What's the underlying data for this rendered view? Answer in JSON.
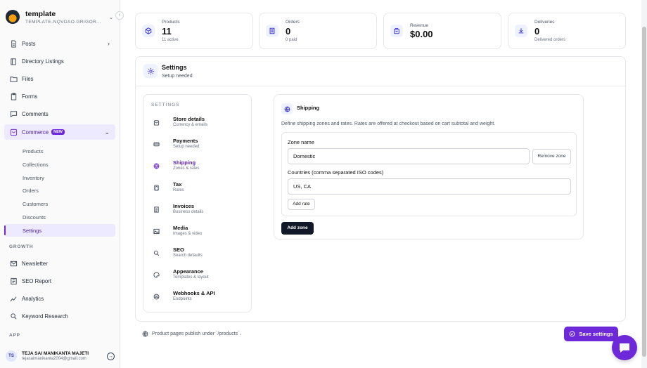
{
  "workspace": {
    "name": "template",
    "slug": "TEMPLATE-NQVDAO.GRIGOR..."
  },
  "sidebar": {
    "items": [
      {
        "label": "Posts",
        "icon": "document-icon"
      },
      {
        "label": "Directory Listings",
        "icon": "book-icon"
      },
      {
        "label": "Files",
        "icon": "folder-icon"
      },
      {
        "label": "Forms",
        "icon": "clipboard-icon"
      },
      {
        "label": "Comments",
        "icon": "comment-icon"
      },
      {
        "label": "Commerce",
        "icon": "cart-icon",
        "badge": "NEW"
      }
    ],
    "commerce_sub": [
      "Products",
      "Collections",
      "Inventory",
      "Orders",
      "Customers",
      "Discounts",
      "Settings"
    ],
    "growth_heading": "GROWTH",
    "growth_items": [
      {
        "label": "Newsletter",
        "icon": "mail-icon"
      },
      {
        "label": "SEO Report",
        "icon": "report-icon"
      },
      {
        "label": "Analytics",
        "icon": "chart-icon"
      },
      {
        "label": "Keyword Research",
        "icon": "search-icon"
      }
    ],
    "app_heading": "APP"
  },
  "user": {
    "initials": "TS",
    "name": "TEJA SAI MANIKANTA MAJETI",
    "email": "tejasaimanikanta2004@gmail.com"
  },
  "stats": [
    {
      "label": "Products",
      "value": "11",
      "sub": "11 active",
      "icon": "cube-icon"
    },
    {
      "label": "Orders",
      "value": "0",
      "sub": "0 paid",
      "icon": "receipt-icon"
    },
    {
      "label": "Revenue",
      "value": "$0.00",
      "sub": "",
      "icon": "bag-icon"
    },
    {
      "label": "Deliveries",
      "value": "0",
      "sub": "Delivered orders",
      "icon": "download-icon"
    }
  ],
  "settings": {
    "title": "Settings",
    "subtitle": "Setup needed",
    "nav_heading": "SETTINGS",
    "nav": [
      {
        "title": "Store details",
        "sub": "Currency & emails",
        "icon": "store-icon"
      },
      {
        "title": "Payments",
        "sub": "Setup needed",
        "icon": "card-icon"
      },
      {
        "title": "Shipping",
        "sub": "Zones & rates",
        "icon": "globe-icon"
      },
      {
        "title": "Tax",
        "sub": "Rates",
        "icon": "calculator-icon"
      },
      {
        "title": "Invoices",
        "sub": "Business details",
        "icon": "invoice-icon"
      },
      {
        "title": "Media",
        "sub": "Images & video",
        "icon": "image-icon"
      },
      {
        "title": "SEO",
        "sub": "Search defaults",
        "icon": "search-icon"
      },
      {
        "title": "Appearance",
        "sub": "Templates & layout",
        "icon": "palette-icon"
      },
      {
        "title": "Webhooks & API",
        "sub": "Endpoints",
        "icon": "webhook-icon"
      }
    ],
    "active_nav": "Shipping"
  },
  "shipping": {
    "title": "Shipping",
    "description": "Define shipping zones and rates. Rates are offered at checkout based on cart subtotal and weight.",
    "zone_label": "Zone name",
    "zone_value": "Domestic",
    "remove_zone": "Remove zone",
    "countries_label": "Countries (comma separated ISO codes)",
    "countries_value": "US, CA",
    "add_rate": "Add rate",
    "add_zone": "Add zone"
  },
  "footer": {
    "note": "Product pages publish under `/products`.",
    "save": "Save settings"
  },
  "colors": {
    "accent": "#6d28d9",
    "dark": "#111827"
  }
}
